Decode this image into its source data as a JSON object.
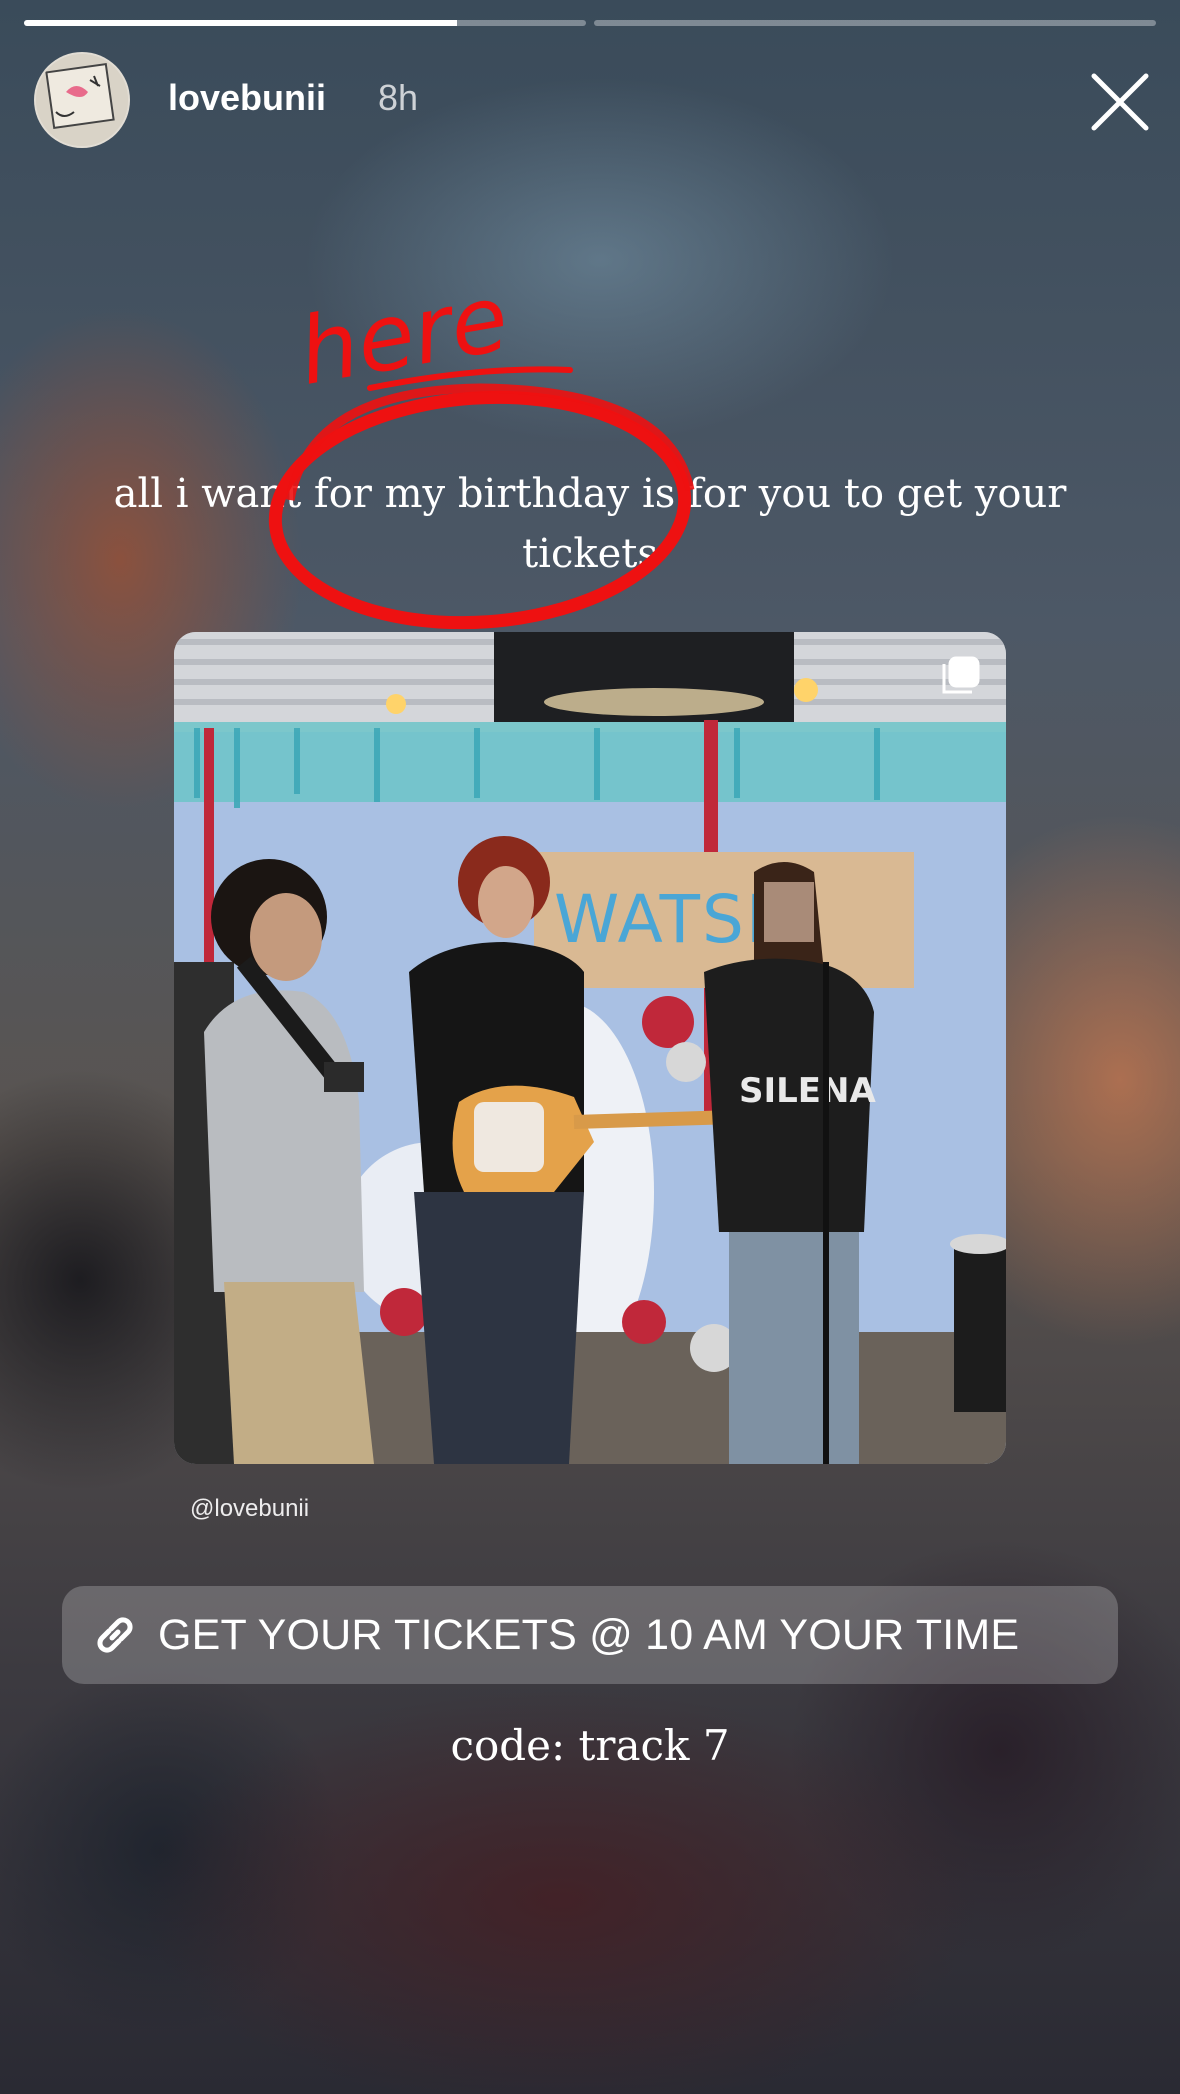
{
  "story": {
    "progress": [
      0.77,
      0.0
    ]
  },
  "header": {
    "username": "lovebunii",
    "time": "8h",
    "close_icon": "close-icon"
  },
  "annotation": {
    "text": "here",
    "color": "#ee1111"
  },
  "caption": {
    "text": "all i want for my birthday is for you to get your tickets"
  },
  "photo": {
    "banner_text": "WATSN",
    "shirt_text": "SILENA",
    "icon": "instagram-post-icon"
  },
  "mention": {
    "handle": "@lovebunii"
  },
  "link_sticker": {
    "icon": "link-icon",
    "label": "GET YOUR TICKETS @ 10 AM YOUR TIME"
  },
  "footer": {
    "code": "code: track 7"
  }
}
